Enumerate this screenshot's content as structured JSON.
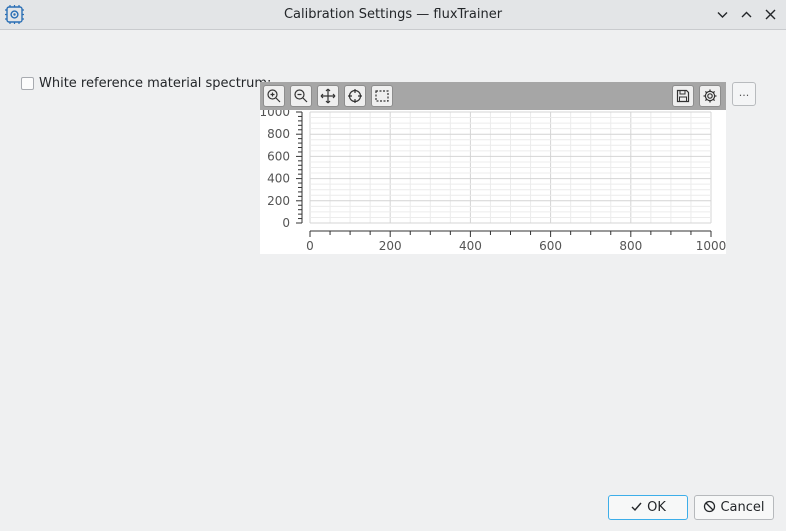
{
  "window": {
    "title": "Calibration Settings — fluxTrainer",
    "app_icon": "chip-gear-icon",
    "controls": [
      "minimize-icon",
      "maximize-icon",
      "close-icon"
    ]
  },
  "form": {
    "checkbox_label": "White reference material spectrum:",
    "checkbox_checked": false
  },
  "plot": {
    "toolbar": [
      "zoom-in-icon",
      "zoom-out-icon",
      "pan-icon",
      "crosshair-icon",
      "select-region-icon",
      "save-icon",
      "settings-icon"
    ],
    "more_label": "..."
  },
  "chart_data": {
    "type": "line",
    "title": "",
    "xlabel": "",
    "ylabel": "",
    "xlim": [
      0,
      1000
    ],
    "ylim": [
      0,
      1000
    ],
    "xticks": [
      "0",
      "200",
      "400",
      "600",
      "800",
      "1000"
    ],
    "yticks": [
      "0",
      "200",
      "400",
      "600",
      "800",
      "1000"
    ],
    "grid": true,
    "series": []
  },
  "buttons": {
    "ok_label": "OK",
    "cancel_label": "Cancel"
  },
  "colors": {
    "accent": "#3daee9",
    "toolbar_bg": "#a6a6a6",
    "window_bg": "#eff0f1"
  }
}
